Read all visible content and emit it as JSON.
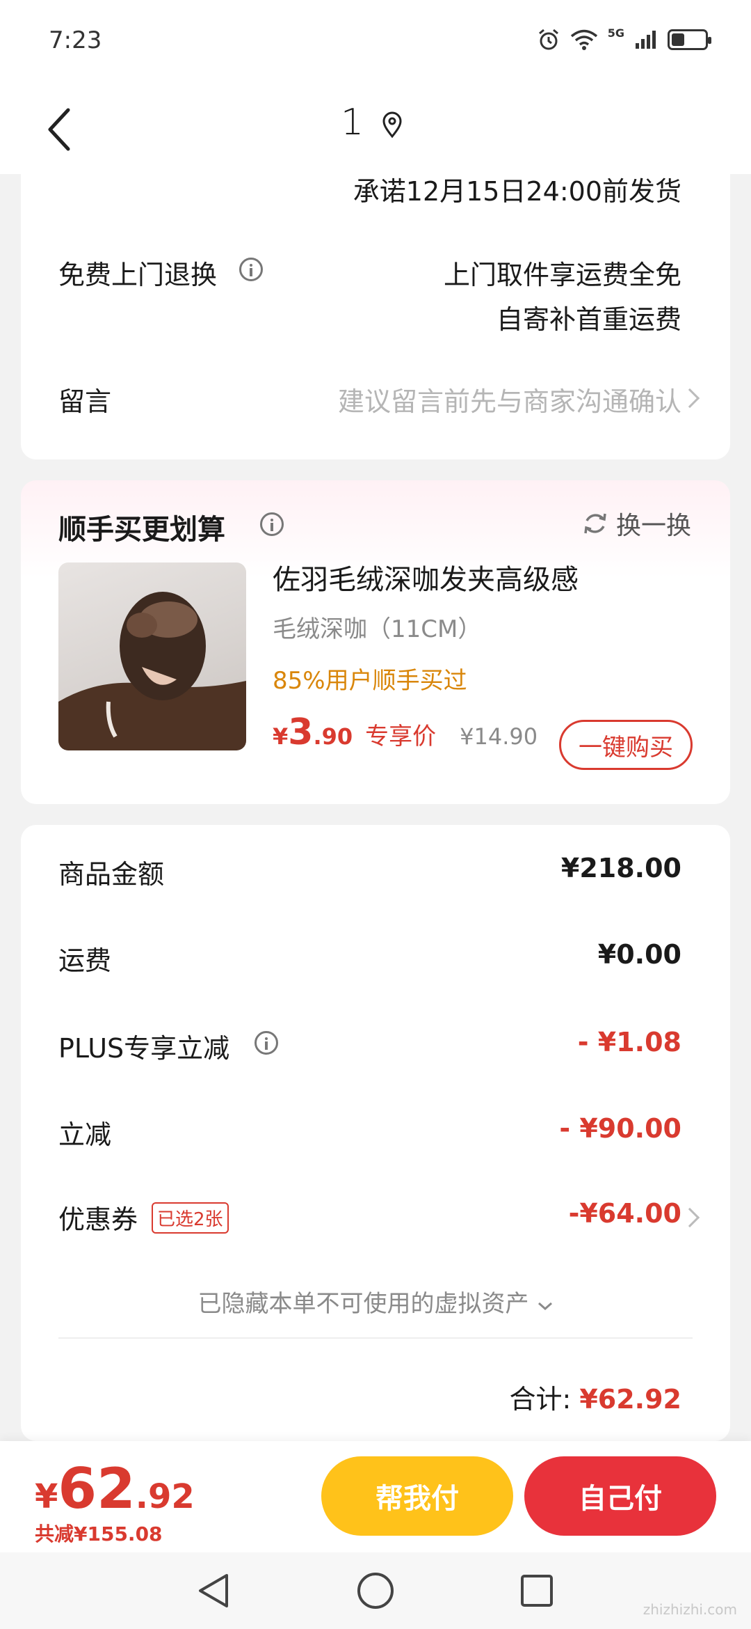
{
  "status": {
    "time": "7:23",
    "network": "5G"
  },
  "nav": {
    "title": "1"
  },
  "shipping": {
    "promise": "承诺12月15日24:00前发货",
    "return_label": "免费上门退换",
    "return_line1": "上门取件享运费全免",
    "return_line2": "自寄补首重运费",
    "message_label": "留言",
    "message_placeholder": "建议留言前先与商家沟通确认"
  },
  "recommend": {
    "title": "顺手买更划算",
    "refresh_label": "换一换",
    "product_name": "佐羽毛绒深咖发夹高级感",
    "product_spec": "毛绒深咖（11CM）",
    "stat": "85%用户顺手买过",
    "currency": "¥",
    "price_int": "3",
    "price_dec": ".90",
    "price_tag": "专享价",
    "orig_price": "¥14.90",
    "buy_label": "一键购买"
  },
  "summary": {
    "rows": [
      {
        "label": "商品金额",
        "value": "¥218.00"
      },
      {
        "label": "运费",
        "value": "¥0.00"
      },
      {
        "label": "PLUS专享立减",
        "value": "- ¥1.08"
      },
      {
        "label": "立减",
        "value": "- ¥90.00"
      },
      {
        "label": "优惠券",
        "value": "-¥64.00",
        "tag": "已选2张"
      }
    ],
    "hidden_assets": "已隐藏本单不可使用的虚拟资产",
    "total_label": "合计:",
    "total_value": "¥62.92"
  },
  "bottom": {
    "currency": "¥",
    "price_int": "62",
    "price_dec": ".92",
    "saved": "共减¥155.08",
    "help_pay": "帮我付",
    "self_pay": "自己付"
  },
  "watermark": "zhizhizhi.com",
  "colors": {
    "accent_red": "#d93a2f",
    "orange": "#d9860a",
    "yellow_btn": "#ffc21a",
    "red_btn": "#e8323b"
  }
}
